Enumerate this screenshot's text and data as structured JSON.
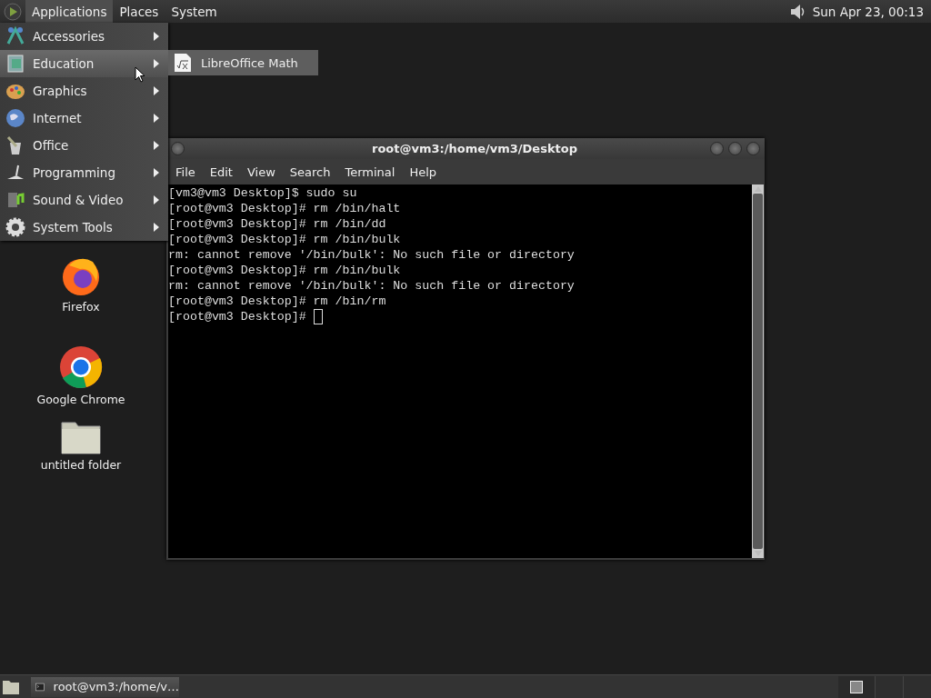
{
  "top_panel": {
    "menus": [
      {
        "label": "Applications",
        "selected": true
      },
      {
        "label": "Places",
        "selected": false
      },
      {
        "label": "System",
        "selected": false
      }
    ],
    "clock": "Sun Apr 23, 00:13"
  },
  "applications_menu": {
    "items": [
      {
        "label": "Accessories",
        "selected": false
      },
      {
        "label": "Education",
        "selected": true
      },
      {
        "label": "Graphics",
        "selected": false
      },
      {
        "label": "Internet",
        "selected": false
      },
      {
        "label": "Office",
        "selected": false
      },
      {
        "label": "Programming",
        "selected": false
      },
      {
        "label": "Sound & Video",
        "selected": false
      },
      {
        "label": "System Tools",
        "selected": false
      }
    ]
  },
  "submenu": {
    "items": [
      {
        "label": "LibreOffice Math"
      }
    ]
  },
  "desktop_icons": [
    {
      "label": "Firefox"
    },
    {
      "label": "Google Chrome"
    },
    {
      "label": "untitled folder"
    }
  ],
  "terminal": {
    "title": "root@vm3:/home/vm3/Desktop",
    "menus": [
      "File",
      "Edit",
      "View",
      "Search",
      "Terminal",
      "Help"
    ],
    "lines": [
      "[vm3@vm3 Desktop]$ sudo su",
      "[root@vm3 Desktop]# rm /bin/halt",
      "[root@vm3 Desktop]# rm /bin/dd",
      "[root@vm3 Desktop]# rm /bin/bulk",
      "rm: cannot remove '/bin/bulk': No such file or directory",
      "[root@vm3 Desktop]# rm /bin/bulk",
      "rm: cannot remove '/bin/bulk': No such file or directory",
      "[root@vm3 Desktop]# rm /bin/rm"
    ],
    "prompt": "[root@vm3 Desktop]# "
  },
  "taskbar": {
    "tasks": [
      {
        "label": "root@vm3:/home/v…"
      }
    ]
  }
}
